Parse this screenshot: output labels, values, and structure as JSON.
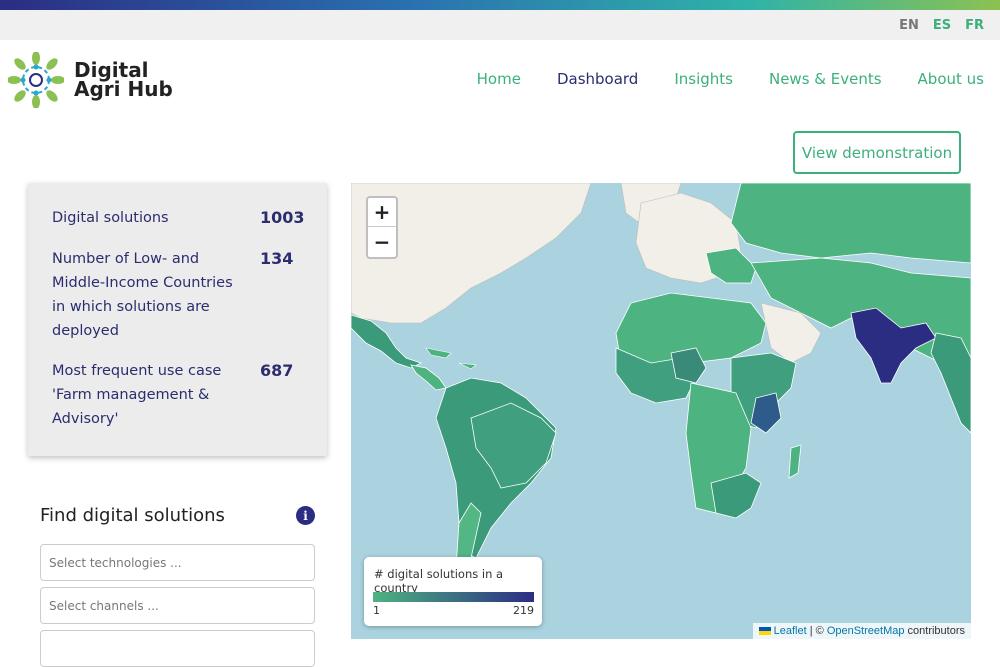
{
  "languages": [
    {
      "label": "EN",
      "active": true
    },
    {
      "label": "ES",
      "active": false
    },
    {
      "label": "FR",
      "active": false
    }
  ],
  "brand": {
    "line1": "Digital",
    "line2": "Agri Hub"
  },
  "nav": [
    "Home",
    "Dashboard",
    "Insights",
    "News & Events",
    "About us"
  ],
  "demo_button": "View demonstration",
  "stats": [
    {
      "label": "Digital solutions",
      "value": "1003"
    },
    {
      "label": "Number of Low- and Middle-Income Countries in which solutions are deployed",
      "value": "134"
    },
    {
      "label": "Most frequent use case 'Farm management & Advisory'",
      "value": "687"
    }
  ],
  "find": {
    "title": "Find digital solutions",
    "info": "i"
  },
  "filters": [
    {
      "placeholder": "Select technologies ..."
    },
    {
      "placeholder": "Select channels ..."
    }
  ],
  "map": {
    "zoom_in": "+",
    "zoom_out": "−",
    "legend": {
      "title": "# digital solutions in a country",
      "min": "1",
      "max": "219"
    },
    "attribution": {
      "leaflet": "Leaflet",
      "sep": " | © ",
      "osm": "OpenStreetMap",
      "tail": " contributors"
    }
  }
}
